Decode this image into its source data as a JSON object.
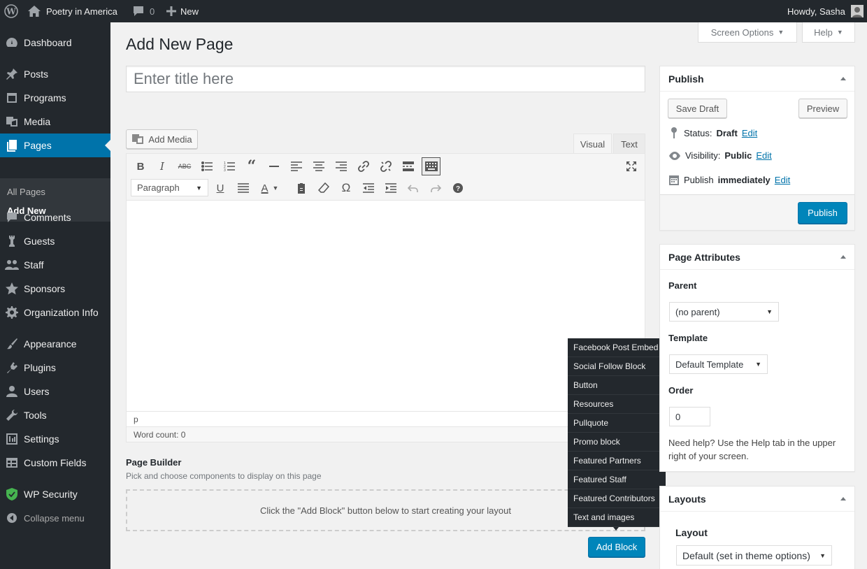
{
  "admin_bar": {
    "site_name": "Poetry in America",
    "comments_count": "0",
    "new_label": "New",
    "howdy": "Howdy, Sasha"
  },
  "sidebar": {
    "items": [
      {
        "label": "Dashboard",
        "icon": "dashboard-icon"
      },
      {
        "label": "Posts",
        "icon": "pin-icon"
      },
      {
        "label": "Programs",
        "icon": "programs-icon"
      },
      {
        "label": "Media",
        "icon": "media-icon"
      },
      {
        "label": "Pages",
        "icon": "pages-icon"
      },
      {
        "label": "Comments",
        "icon": "comment-icon"
      },
      {
        "label": "Guests",
        "icon": "chess-icon"
      },
      {
        "label": "Staff",
        "icon": "groups-icon"
      },
      {
        "label": "Sponsors",
        "icon": "star-icon"
      },
      {
        "label": "Organization Info",
        "icon": "gear-icon"
      },
      {
        "label": "Appearance",
        "icon": "brush-icon"
      },
      {
        "label": "Plugins",
        "icon": "plugin-icon"
      },
      {
        "label": "Users",
        "icon": "user-icon"
      },
      {
        "label": "Tools",
        "icon": "wrench-icon"
      },
      {
        "label": "Settings",
        "icon": "settings-icon"
      },
      {
        "label": "Custom Fields",
        "icon": "table-icon"
      },
      {
        "label": "WP Security",
        "icon": "shield-icon"
      }
    ],
    "submenu": [
      "All Pages",
      "Add New"
    ],
    "collapse_label": "Collapse menu"
  },
  "page": {
    "title": "Add New Page",
    "title_placeholder": "Enter title here"
  },
  "screen_options": "Screen Options",
  "help": "Help",
  "editor": {
    "add_media": "Add Media",
    "tab_visual": "Visual",
    "tab_text": "Text",
    "format_select": "Paragraph",
    "path": "p",
    "word_count": "Word count: 0"
  },
  "page_builder": {
    "heading": "Page Builder",
    "description": "Pick and choose components to display on this page",
    "placeholder": "Click the \"Add Block\" button below to start creating your layout",
    "add_block": "Add Block",
    "menu": [
      "Facebook Post Embed",
      "Social Follow Block",
      "Button",
      "Resources",
      "Pullquote",
      "Promo block",
      "Featured Partners",
      "Featured Staff",
      "Featured Contributors",
      "Text and images"
    ]
  },
  "publish": {
    "heading": "Publish",
    "save_draft": "Save Draft",
    "preview": "Preview",
    "status_label": "Status:",
    "status_value": "Draft",
    "visibility_label": "Visibility:",
    "visibility_value": "Public",
    "publish_label": "Publish",
    "publish_value": "immediately",
    "edit": "Edit",
    "publish_button": "Publish"
  },
  "attributes": {
    "heading": "Page Attributes",
    "parent_label": "Parent",
    "parent_value": "(no parent)",
    "template_label": "Template",
    "template_value": "Default Template",
    "order_label": "Order",
    "order_value": "0",
    "help_text": "Need help? Use the Help tab in the upper right of your screen."
  },
  "layouts": {
    "heading": "Layouts",
    "layout_label": "Layout",
    "layout_value": "Default (set in theme options)"
  },
  "colors": {
    "accent": "#0073aa",
    "sidebar_bg": "#23282d",
    "button_primary": "#0085ba"
  }
}
